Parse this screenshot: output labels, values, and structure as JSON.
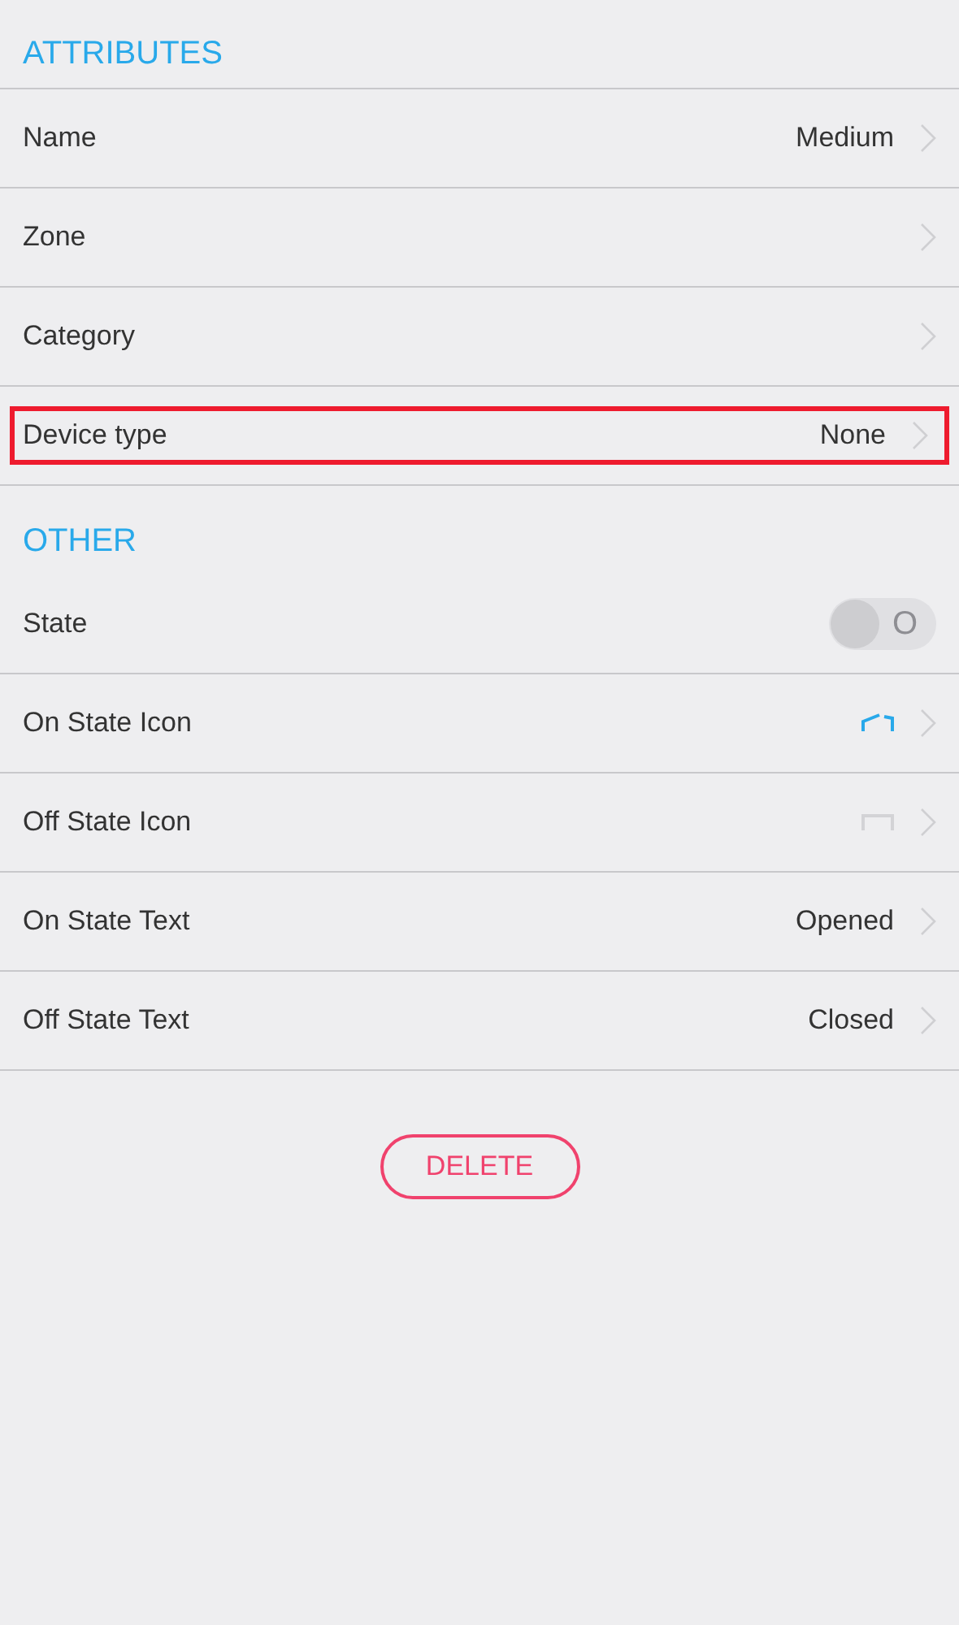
{
  "sections": [
    {
      "title": "ATTRIBUTES",
      "items": [
        {
          "kind": "link",
          "label": "Name",
          "value": "Medium",
          "highlighted": false
        },
        {
          "kind": "link",
          "label": "Zone",
          "highlighted": false
        },
        {
          "kind": "link",
          "label": "Category",
          "highlighted": false
        },
        {
          "kind": "link",
          "label": "Device type",
          "value": "None",
          "highlighted": true
        }
      ]
    },
    {
      "title": "OTHER",
      "items": [
        {
          "kind": "toggle",
          "label": "State",
          "on": false,
          "toggle_text": "O"
        },
        {
          "kind": "icon",
          "label": "On State Icon",
          "active": true
        },
        {
          "kind": "icon",
          "label": "Off State Icon",
          "active": false
        },
        {
          "kind": "link",
          "label": "On State Text",
          "value": "Opened",
          "highlighted": false
        },
        {
          "kind": "link",
          "label": "Off State Text",
          "value": "Closed",
          "highlighted": false
        }
      ]
    }
  ],
  "delete_button": "DELETE"
}
